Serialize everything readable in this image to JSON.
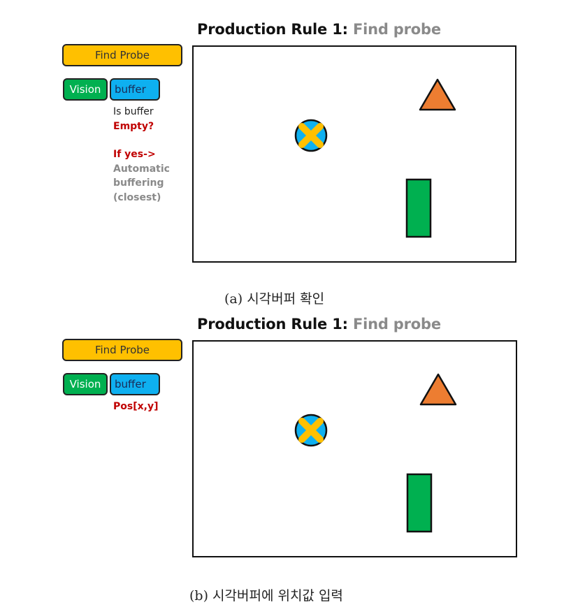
{
  "panels": [
    {
      "title_main": "Production Rule 1:",
      "title_sub": "Find probe",
      "goal_label": "Find Probe",
      "module_label": "Vision",
      "buffer_label": "buffer",
      "notes": [
        {
          "text": "Is buffer",
          "style": "dark"
        },
        {
          "text": "Empty?",
          "style": "red"
        },
        {
          "text": "",
          "style": "dark"
        },
        {
          "text": "If yes->",
          "style": "red"
        },
        {
          "text": "Automatic",
          "style": "gray"
        },
        {
          "text": "buffering",
          "style": "gray"
        },
        {
          "text": "(closest)",
          "style": "gray"
        }
      ],
      "caption": "(a) 시각버퍼 확인"
    },
    {
      "title_main": "Production Rule 1:",
      "title_sub": "Find probe",
      "goal_label": "Find Probe",
      "module_label": "Vision",
      "buffer_label": "buffer",
      "notes": [
        {
          "text": "Pos[x,y]",
          "style": "red"
        }
      ],
      "caption": "(b) 시각버퍼에 위치값 입력"
    }
  ],
  "scene_objects": [
    {
      "name": "probe-circle-x",
      "shape": "circle-with-x",
      "fill": "#0eb0f0",
      "mark": "#ffc000"
    },
    {
      "name": "triangle",
      "shape": "triangle",
      "fill": "#ed7d31"
    },
    {
      "name": "rectangle",
      "shape": "rectangle",
      "fill": "#00b050"
    }
  ],
  "colors": {
    "goal": "#ffc000",
    "module": "#00b050",
    "buffer": "#0eb0f0",
    "emphasis": "#c00000",
    "muted": "#8a8a8a"
  }
}
